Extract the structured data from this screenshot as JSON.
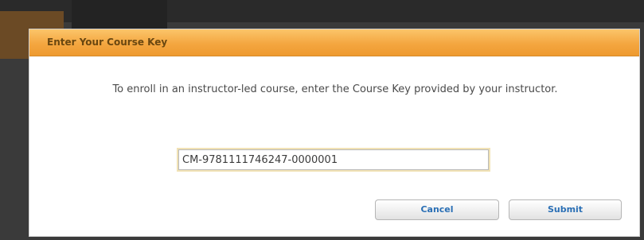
{
  "dialog": {
    "title": "Enter Your Course Key",
    "message": "To enroll in an instructor-led course, enter the Course Key provided by your instructor.",
    "course_key_value": "CM-9781111746247-0000001",
    "cancel_label": "Cancel",
    "submit_label": "Submit"
  },
  "colors": {
    "header_orange": "#f4a640",
    "title_text": "#6a4710",
    "button_text": "#2a6fb5"
  }
}
